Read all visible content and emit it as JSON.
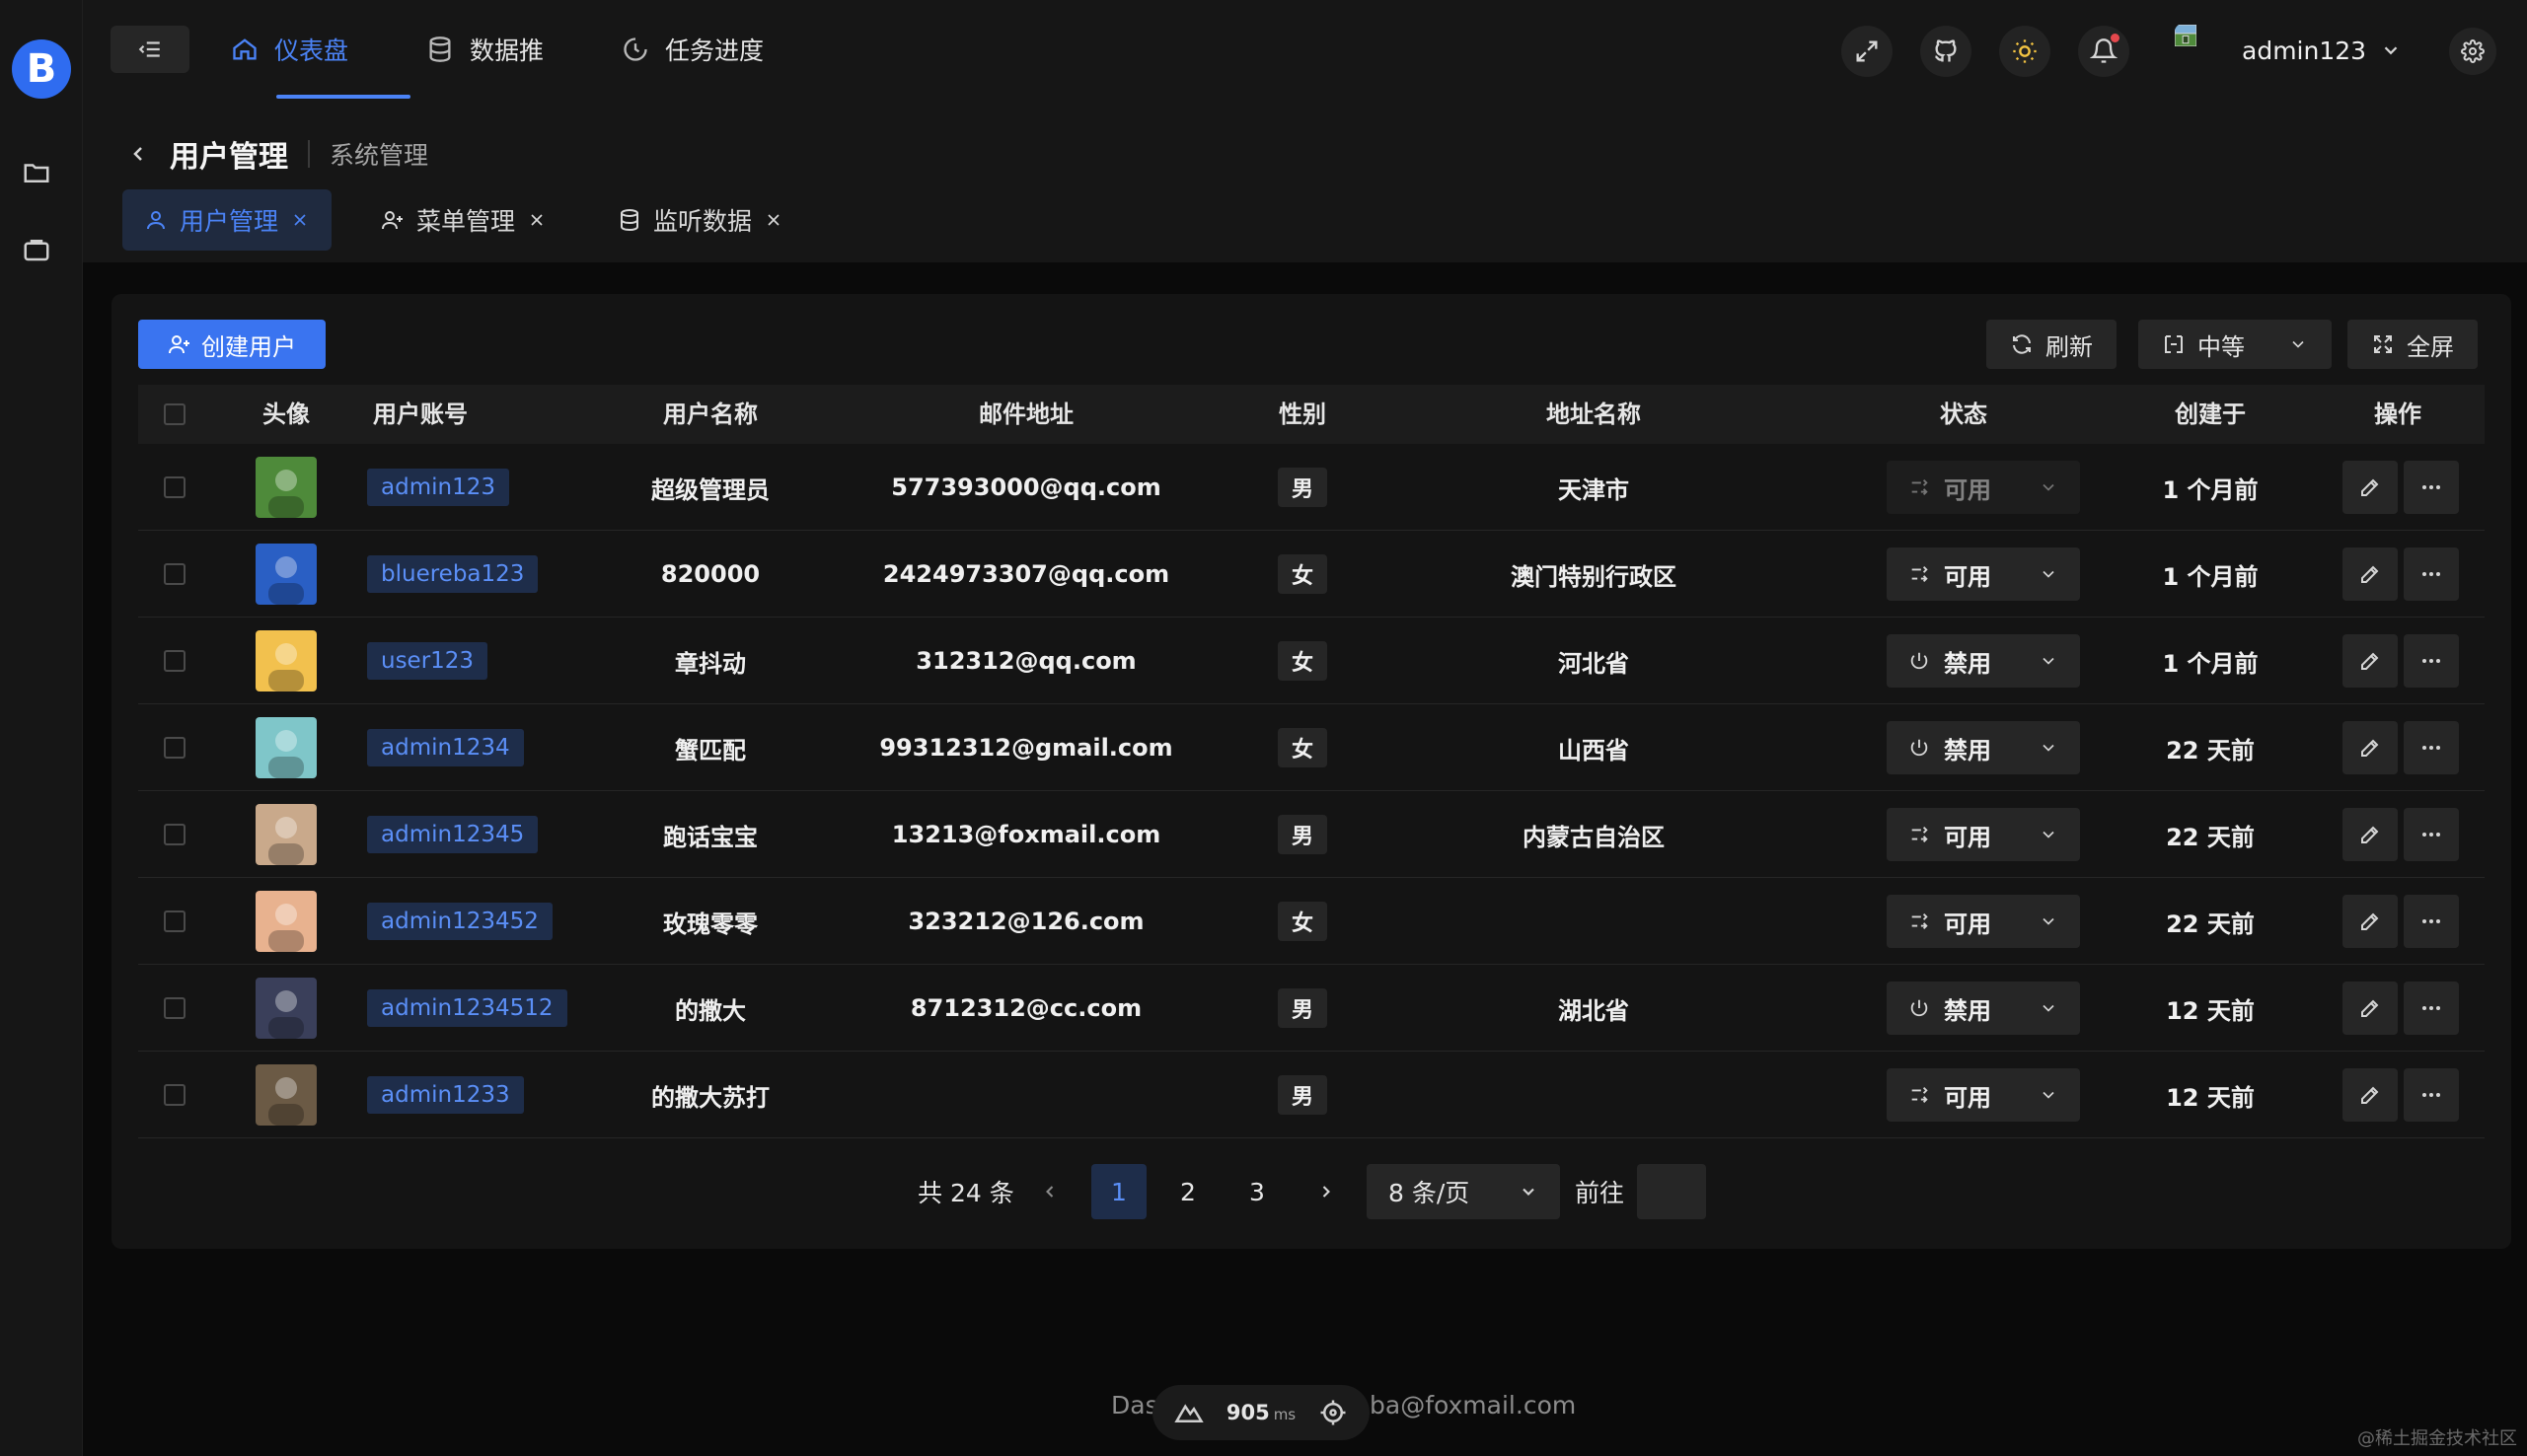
{
  "logo": {
    "letter": "B"
  },
  "rail": {
    "icons": [
      "folder-icon",
      "briefcase-icon"
    ]
  },
  "header": {
    "nav": [
      {
        "label": "仪表盘",
        "icon": "home-icon",
        "active": true
      },
      {
        "label": "数据推",
        "icon": "database-icon",
        "active": false
      },
      {
        "label": "任务进度",
        "icon": "progress-icon",
        "active": false
      }
    ],
    "user": {
      "name": "admin123"
    }
  },
  "breadcrumb": {
    "current": "用户管理",
    "parent": "系统管理"
  },
  "tabs": [
    {
      "label": "用户管理",
      "icon": "user-icon",
      "active": true
    },
    {
      "label": "菜单管理",
      "icon": "user-add-icon",
      "active": false
    },
    {
      "label": "监听数据",
      "icon": "database-icon",
      "active": false
    }
  ],
  "toolbar": {
    "create": "创建用户",
    "refresh": "刷新",
    "density": "中等",
    "fullscreen": "全屏"
  },
  "table": {
    "columns": [
      "头像",
      "用户账号",
      "用户名称",
      "邮件地址",
      "性别",
      "地址名称",
      "状态",
      "创建于",
      "操作"
    ],
    "rows": [
      {
        "account": "admin123",
        "name": "超级管理员",
        "email": "577393000@qq.com",
        "gender": "男",
        "address": "天津市",
        "status": "可用",
        "status_type": "enabled",
        "status_dim": true,
        "created": "1 个月前",
        "avatar_color": "#4e8a3a"
      },
      {
        "account": "bluereba123",
        "name": "820000",
        "email": "2424973307@qq.com",
        "gender": "女",
        "address": "澳门特别行政区",
        "status": "可用",
        "status_type": "enabled",
        "status_dim": false,
        "created": "1 个月前",
        "avatar_color": "#2a5fc4"
      },
      {
        "account": "user123",
        "name": "章抖动",
        "email": "312312@qq.com",
        "gender": "女",
        "address": "河北省",
        "status": "禁用",
        "status_type": "disabled",
        "status_dim": false,
        "created": "1 个月前",
        "avatar_color": "#f2c14e"
      },
      {
        "account": "admin1234",
        "name": "蟹匹配",
        "email": "99312312@gmail.com",
        "gender": "女",
        "address": "山西省",
        "status": "禁用",
        "status_type": "disabled",
        "status_dim": false,
        "created": "22 天前",
        "avatar_color": "#7fc6c9"
      },
      {
        "account": "admin12345",
        "name": "跑话宝宝",
        "email": "13213@foxmail.com",
        "gender": "男",
        "address": "内蒙古自治区",
        "status": "可用",
        "status_type": "enabled",
        "status_dim": false,
        "created": "22 天前",
        "avatar_color": "#c9a98b"
      },
      {
        "account": "admin123452",
        "name": "玫瑰零零",
        "email": "323212@126.com",
        "gender": "女",
        "address": "",
        "status": "可用",
        "status_type": "enabled",
        "status_dim": false,
        "created": "22 天前",
        "avatar_color": "#e8b28f"
      },
      {
        "account": "admin1234512",
        "name": "的撒大",
        "email": "8712312@cc.com",
        "gender": "男",
        "address": "湖北省",
        "status": "禁用",
        "status_type": "disabled",
        "status_dim": false,
        "created": "12 天前",
        "avatar_color": "#3a3f5a"
      },
      {
        "account": "admin1233",
        "name": "的撒大苏打",
        "email": "",
        "gender": "男",
        "address": "",
        "status": "可用",
        "status_type": "enabled",
        "status_dim": false,
        "created": "12 天前",
        "avatar_color": "#6b5a45"
      }
    ]
  },
  "pagination": {
    "total": "共 24 条",
    "pages": [
      "1",
      "2",
      "3"
    ],
    "current": "1",
    "page_size": "8 条/页",
    "goto": "前往",
    "goto_value": ""
  },
  "footer": {
    "left": "Das",
    "right": "ba@foxmail.com",
    "perf_value": "905",
    "perf_unit": "ms"
  },
  "watermark": "@稀土掘金技术社区",
  "colors": {
    "accent": "#4b83f6",
    "primary_button": "#3a74f0",
    "background": "#0a0a0a",
    "panel": "#161616"
  }
}
